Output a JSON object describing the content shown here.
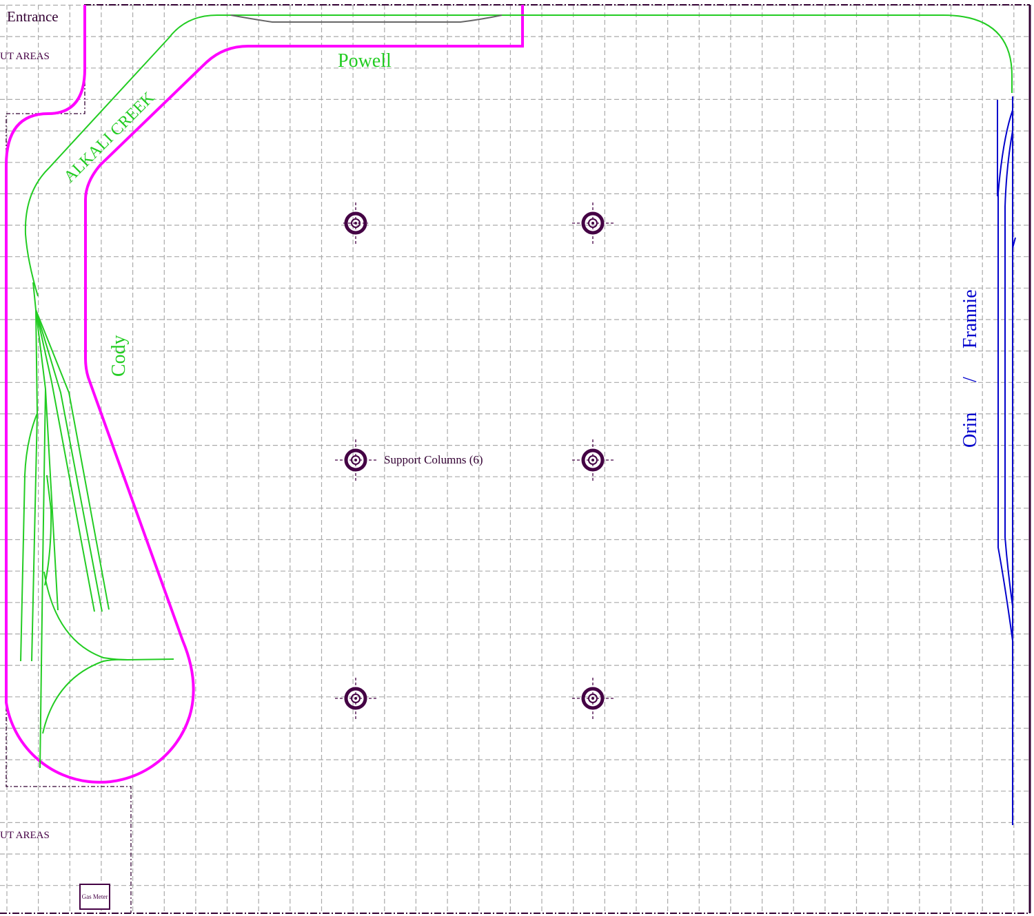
{
  "labels": {
    "entrance": "Entrance",
    "keep_out_top": "UT AREAS",
    "keep_out_bottom": "UT AREAS",
    "alkali_creek": "ALKALI CREEK",
    "powell": "Powell",
    "cody": "Cody",
    "frannie": "Frannie",
    "separator": "/",
    "orin": "Orin",
    "support_columns": "Support Columns (6)",
    "gas_meter": "Gas Meter"
  },
  "colors": {
    "background": "#ffffff",
    "grid": "#aaaaaa",
    "walls": "#330033",
    "benchwork": "#ff00ff",
    "track_green": "#22cc22",
    "track_blue": "#0000cc",
    "track_gray": "#666666",
    "column": "#440044"
  },
  "support_columns": {
    "count": 6
  }
}
